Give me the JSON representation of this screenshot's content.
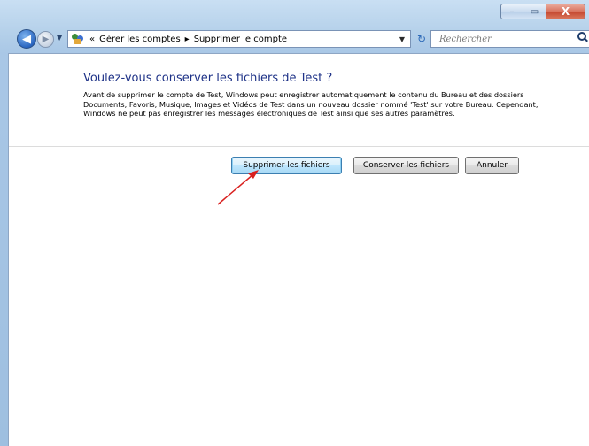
{
  "window": {
    "caption": {
      "minimize": "–",
      "maximize": "▭",
      "close": "X"
    }
  },
  "nav": {
    "back_glyph": "◀",
    "forward_glyph": "▶",
    "history_glyph": "▼",
    "breadcrumb_prefix": "«",
    "breadcrumbs": [
      "Gérer les comptes",
      "Supprimer le compte"
    ],
    "breadcrumb_separator": "▸",
    "dropdown_glyph": "▼",
    "refresh_glyph": "↻",
    "search_placeholder": "Rechercher"
  },
  "dialog": {
    "heading": "Voulez-vous conserver les fichiers de Test ?",
    "description": "Avant de supprimer le compte de Test, Windows peut enregistrer automatiquement le contenu du Bureau et des dossiers Documents, Favoris, Musique, Images et Vidéos de Test dans un nouveau dossier nommé 'Test' sur votre Bureau. Cependant, Windows ne peut pas enregistrer les messages électroniques de Test ainsi que ses autres paramètres.",
    "buttons": {
      "delete_files": "Supprimer les fichiers",
      "keep_files": "Conserver les fichiers",
      "cancel": "Annuler"
    }
  },
  "colors": {
    "heading": "#1e3287",
    "annotation_arrow": "#d9201f",
    "frame": "#a9c7e6"
  },
  "icons": {
    "folder": "user-accounts-icon",
    "search": "search-icon",
    "refresh": "refresh-icon"
  }
}
